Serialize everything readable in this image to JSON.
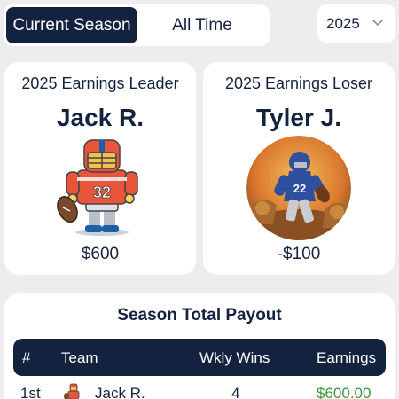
{
  "tabs": [
    {
      "label": "Current Season",
      "active": true
    },
    {
      "label": "All Time",
      "active": false
    }
  ],
  "year_select": {
    "value": "2025",
    "icon": "chevron-down-icon"
  },
  "leader_card": {
    "title": "2025 Earnings Leader",
    "name": "Jack R.",
    "jersey_number": "32",
    "amount": "$600"
  },
  "loser_card": {
    "title": "2025 Earnings Loser",
    "name": "Tyler J.",
    "jersey_number": "22",
    "amount": "-$100"
  },
  "payout": {
    "title": "Season Total Payout",
    "columns": [
      "#",
      "Team",
      "Wkly Wins",
      "Earnings"
    ],
    "rows": [
      {
        "rank": "1st",
        "team": "Jack R.",
        "wins": "4",
        "earnings": "$600.00"
      }
    ]
  },
  "colors": {
    "navy": "#13233f",
    "background": "#ededf0",
    "money_green": "#3a9a3c",
    "jersey_orange": "#e8553a"
  }
}
